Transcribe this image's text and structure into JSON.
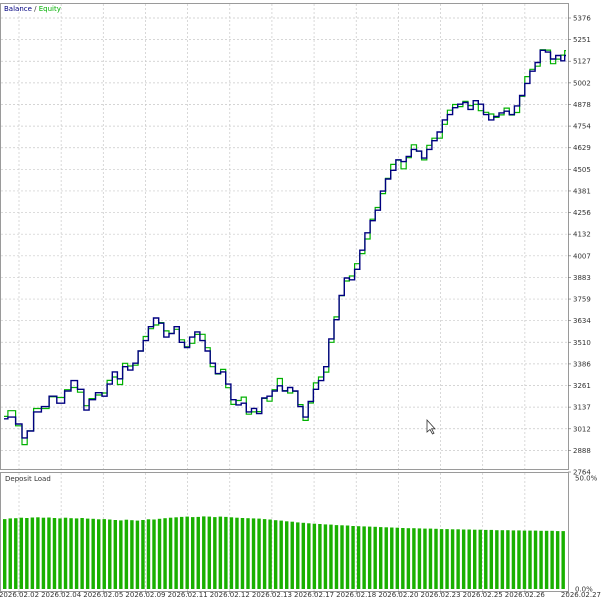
{
  "chart_data": [
    {
      "type": "line",
      "legend": {
        "placement": "top-left"
      },
      "series": [
        {
          "name": "Balance",
          "color": "#000080"
        },
        {
          "name": "Equity",
          "color": "#00b000"
        }
      ],
      "x_tick_labels": [
        "2026.02.02",
        "2026.02.04",
        "2026.02.05",
        "2026.02.09",
        "2026.02.11",
        "2026.02.12",
        "2026.02.13",
        "2026.02.17",
        "2026.02.18",
        "2026.02.20",
        "2026.02.23",
        "2026.02.25",
        "2026.02.26",
        "2026.02.27"
      ],
      "y_tick_labels": [
        "5376",
        "5251",
        "5127",
        "5002",
        "4878",
        "4754",
        "4629",
        "4505",
        "4381",
        "4256",
        "4132",
        "4007",
        "3883",
        "3759",
        "3634",
        "3510",
        "3386",
        "3261",
        "3137",
        "3012",
        "2888",
        "2764"
      ],
      "ylim": [
        2764,
        5376
      ],
      "grid": true,
      "points": [
        [
          0,
          3070
        ],
        [
          3,
          3080
        ],
        [
          6,
          3040
        ],
        [
          8,
          2960
        ],
        [
          10,
          3000
        ],
        [
          13,
          3110
        ],
        [
          16,
          3140
        ],
        [
          19,
          3200
        ],
        [
          22,
          3160
        ],
        [
          25,
          3230
        ],
        [
          27,
          3290
        ],
        [
          30,
          3240
        ],
        [
          32,
          3120
        ],
        [
          34,
          3180
        ],
        [
          37,
          3220
        ],
        [
          39,
          3200
        ],
        [
          41,
          3270
        ],
        [
          43,
          3340
        ],
        [
          45,
          3300
        ],
        [
          47,
          3370
        ],
        [
          49,
          3350
        ],
        [
          51,
          3390
        ],
        [
          53,
          3460
        ],
        [
          55,
          3520
        ],
        [
          57,
          3600
        ],
        [
          59,
          3650
        ],
        [
          61,
          3620
        ],
        [
          63,
          3540
        ],
        [
          65,
          3560
        ],
        [
          67,
          3600
        ],
        [
          69,
          3510
        ],
        [
          71,
          3480
        ],
        [
          73,
          3540
        ],
        [
          75,
          3570
        ],
        [
          77,
          3520
        ],
        [
          79,
          3460
        ],
        [
          81,
          3390
        ],
        [
          83,
          3330
        ],
        [
          85,
          3340
        ],
        [
          87,
          3270
        ],
        [
          89,
          3180
        ],
        [
          91,
          3150
        ],
        [
          93,
          3160
        ],
        [
          95,
          3110
        ],
        [
          97,
          3130
        ],
        [
          99,
          3100
        ],
        [
          101,
          3190
        ],
        [
          103,
          3200
        ],
        [
          105,
          3230
        ],
        [
          107,
          3260
        ],
        [
          109,
          3230
        ],
        [
          111,
          3250
        ],
        [
          113,
          3230
        ],
        [
          115,
          3140
        ],
        [
          117,
          3080
        ],
        [
          119,
          3170
        ],
        [
          121,
          3240
        ],
        [
          123,
          3290
        ],
        [
          125,
          3370
        ],
        [
          127,
          3530
        ],
        [
          129,
          3640
        ],
        [
          131,
          3780
        ],
        [
          133,
          3880
        ],
        [
          135,
          3870
        ],
        [
          137,
          3930
        ],
        [
          139,
          4040
        ],
        [
          141,
          4140
        ],
        [
          143,
          4210
        ],
        [
          145,
          4270
        ],
        [
          147,
          4380
        ],
        [
          149,
          4450
        ],
        [
          151,
          4500
        ],
        [
          153,
          4560
        ],
        [
          155,
          4550
        ],
        [
          157,
          4580
        ],
        [
          159,
          4620
        ],
        [
          161,
          4610
        ],
        [
          163,
          4570
        ],
        [
          165,
          4620
        ],
        [
          167,
          4670
        ],
        [
          169,
          4720
        ],
        [
          171,
          4790
        ],
        [
          173,
          4820
        ],
        [
          175,
          4860
        ],
        [
          177,
          4880
        ],
        [
          179,
          4890
        ],
        [
          181,
          4850
        ],
        [
          183,
          4900
        ],
        [
          185,
          4880
        ],
        [
          187,
          4820
        ],
        [
          189,
          4790
        ],
        [
          191,
          4810
        ],
        [
          193,
          4830
        ],
        [
          195,
          4840
        ],
        [
          197,
          4820
        ],
        [
          199,
          4870
        ],
        [
          201,
          4930
        ],
        [
          203,
          5000
        ],
        [
          205,
          5070
        ],
        [
          207,
          5120
        ],
        [
          209,
          5190
        ],
        [
          211,
          5180
        ],
        [
          213,
          5140
        ],
        [
          215,
          5160
        ],
        [
          217,
          5130
        ],
        [
          218,
          5160
        ]
      ]
    },
    {
      "type": "bar",
      "title": "Deposit Load",
      "y_tick_labels": [
        "50.0%",
        "0.0%"
      ],
      "ylim": [
        0,
        50
      ],
      "values": [
        31.5,
        31.8,
        31.9,
        32.1,
        32.0,
        32.2,
        32.3,
        32.1,
        32.2,
        32.0,
        31.8,
        32.1,
        31.9,
        31.8,
        32.0,
        31.7,
        31.6,
        31.4,
        31.5,
        31.3,
        31.1,
        30.9,
        31.2,
        31.0,
        30.8,
        31.1,
        31.4,
        31.3,
        31.6,
        31.9,
        32.1,
        32.3,
        32.5,
        32.6,
        32.4,
        32.5,
        32.7,
        32.6,
        32.4,
        32.6,
        32.5,
        32.3,
        32.1,
        32.0,
        31.9,
        31.8,
        31.7,
        31.5,
        31.3,
        31.0,
        30.8,
        30.5,
        30.3,
        30.0,
        29.8,
        29.6,
        29.4,
        29.3,
        29.1,
        29.0,
        28.8,
        28.7,
        28.6,
        28.4,
        28.3,
        28.2,
        28.1,
        28.0,
        27.9,
        27.8,
        27.7,
        27.6,
        27.5,
        27.4,
        27.4,
        27.3,
        27.2,
        27.2,
        27.1,
        27.0,
        27.0,
        26.9,
        26.9,
        26.8,
        26.8,
        26.7,
        26.7,
        26.6,
        26.6,
        26.5,
        26.5,
        26.5,
        26.4,
        26.4,
        26.3,
        26.3,
        26.3,
        26.2,
        26.2,
        26.2,
        26.1,
        26.1
      ]
    }
  ]
}
